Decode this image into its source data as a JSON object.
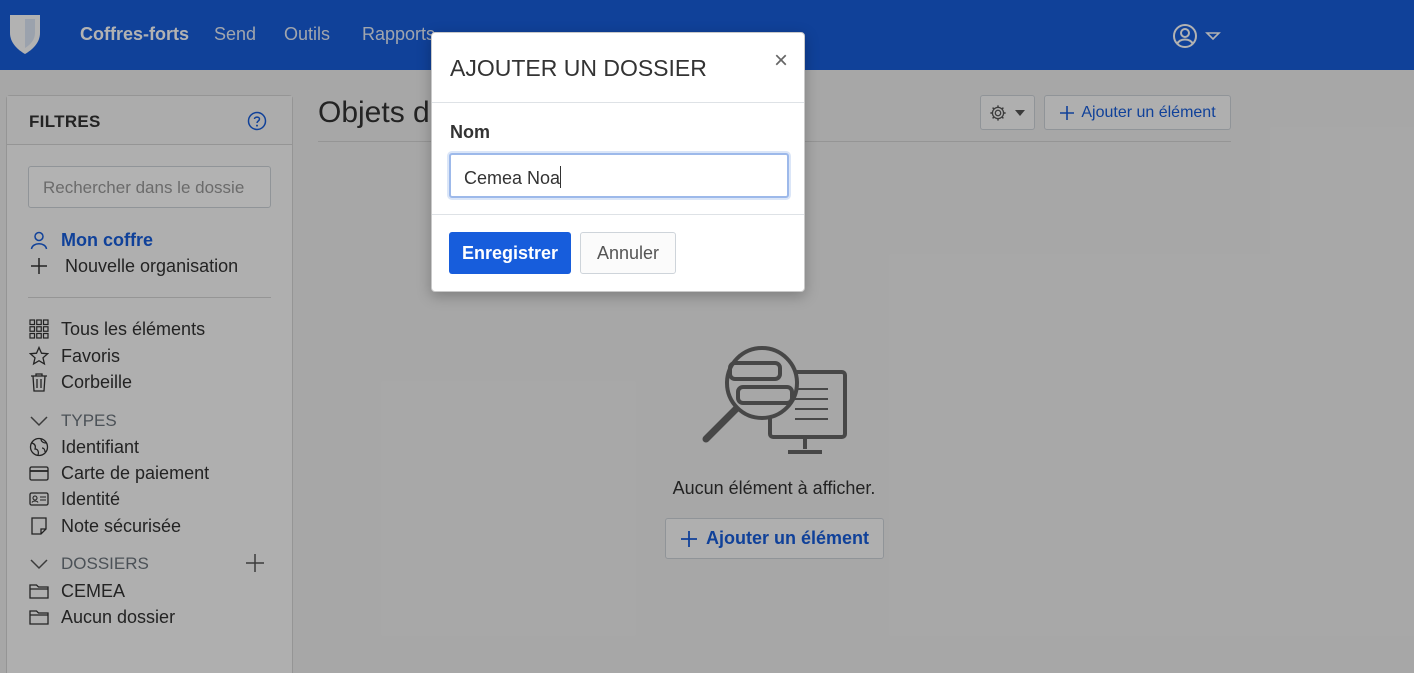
{
  "colors": {
    "brand": "#175ddc",
    "backdrop": "rgba(0,0,0,0.30)"
  },
  "navbar": {
    "logo_icon": "shield-logo-icon",
    "links": [
      "Coffres-forts",
      "Send",
      "Outils",
      "Rapports"
    ],
    "active_link": "Coffres-forts",
    "account_icon": "user-circle-icon"
  },
  "sidebar": {
    "title": "FILTRES",
    "help_icon": "question-circle-icon",
    "search_placeholder": "Rechercher dans le dossie",
    "vault_items": [
      {
        "label": "Mon coffre",
        "icon": "user-icon",
        "active": true
      },
      {
        "label": "Nouvelle organisation",
        "icon": "plus-icon"
      }
    ],
    "filters": [
      {
        "label": "Tous les éléments",
        "icon": "grid-icon"
      },
      {
        "label": "Favoris",
        "icon": "star-icon"
      },
      {
        "label": "Corbeille",
        "icon": "trash-icon"
      }
    ],
    "types_heading": "TYPES",
    "types": [
      {
        "label": "Identifiant",
        "icon": "globe-icon"
      },
      {
        "label": "Carte de paiement",
        "icon": "credit-card-icon"
      },
      {
        "label": "Identité",
        "icon": "id-card-icon"
      },
      {
        "label": "Note sécurisée",
        "icon": "sticky-note-icon"
      }
    ],
    "folders_heading": "DOSSIERS",
    "folders": [
      {
        "label": "CEMEA",
        "icon": "folder-icon"
      },
      {
        "label": "Aucun dossier",
        "icon": "folder-icon"
      }
    ]
  },
  "main": {
    "title": "Objets d",
    "settings_icon": "gear-icon",
    "add_item_label": "Ajouter un élément",
    "empty_message": "Aucun élément à afficher.",
    "empty_add_label": "Ajouter un élément",
    "empty_illustration_icon": "search-monitor-illustration-icon"
  },
  "modal": {
    "title": "AJOUTER UN DOSSIER",
    "close_label": "×",
    "name_label": "Nom",
    "name_value": "Cemea Noa",
    "save_label": "Enregistrer",
    "cancel_label": "Annuler"
  }
}
